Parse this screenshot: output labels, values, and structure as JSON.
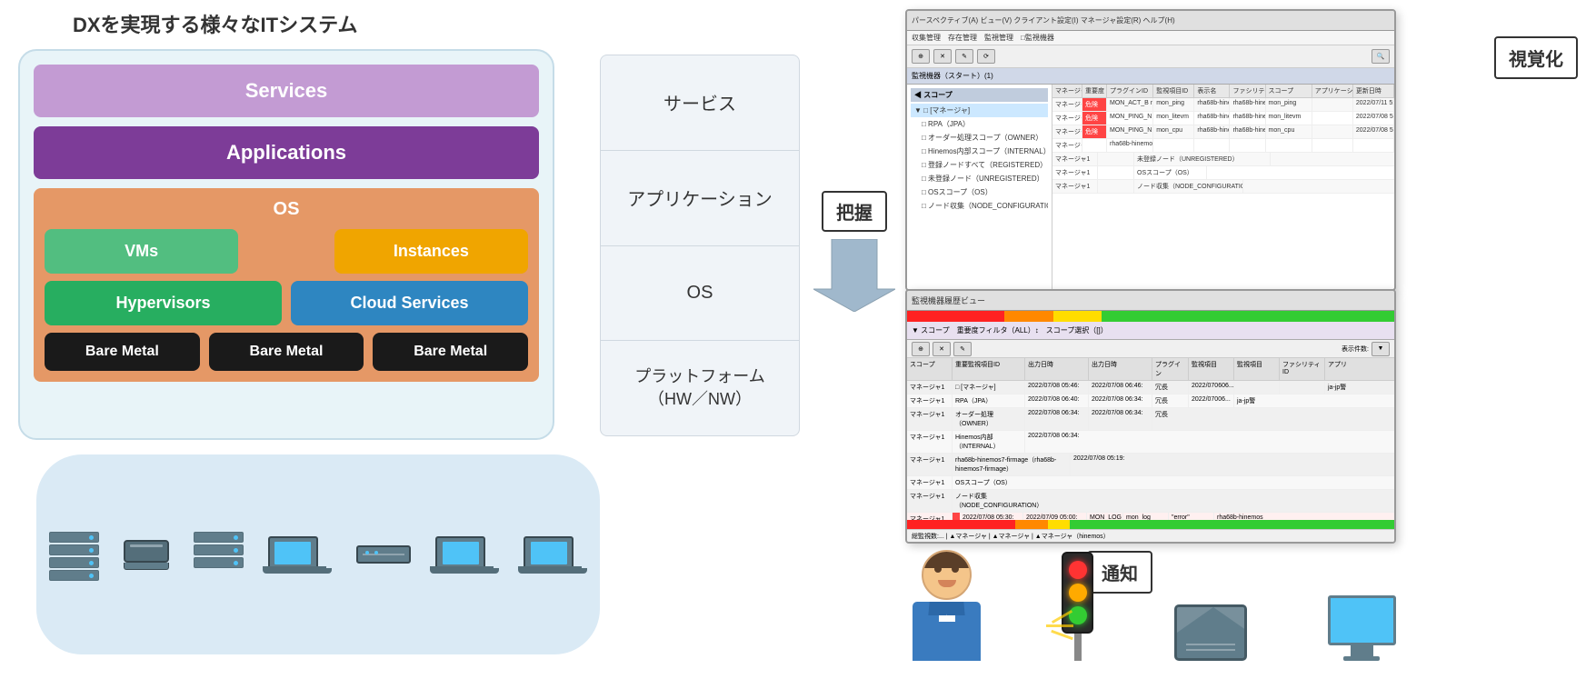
{
  "page": {
    "title": "DXを実現する様々なITシステム",
    "diagram": {
      "services_label": "Services",
      "applications_label": "Applications",
      "os_label": "OS",
      "vms_label": "VMs",
      "instances_label": "Instances",
      "hypervisors_label": "Hypervisors",
      "cloud_services_label": "Cloud Services",
      "bare_metal_1": "Bare Metal",
      "bare_metal_2": "Bare Metal",
      "bare_metal_3": "Bare Metal"
    },
    "middle": {
      "service_label": "サービス",
      "application_label": "アプリケーション",
      "os_label": "OS",
      "platform_label": "プラットフォーム\n（HW／NW）"
    },
    "actions": {
      "grasp_label": "把握",
      "visualize_label": "視覚化",
      "notify_label": "通知"
    },
    "screenshot1": {
      "titlebar": "パースペクティブ(A) ビュー(V) クライアント設定(I) マネージャ設定(R) ヘルプ(H)",
      "menubar_items": [
        "収集管理",
        "存在管理",
        "監視管理"
      ],
      "tab": "監視機器（スタート）(1)"
    },
    "screenshot2": {
      "titlebar": "監視機器履歴ビュー"
    }
  }
}
